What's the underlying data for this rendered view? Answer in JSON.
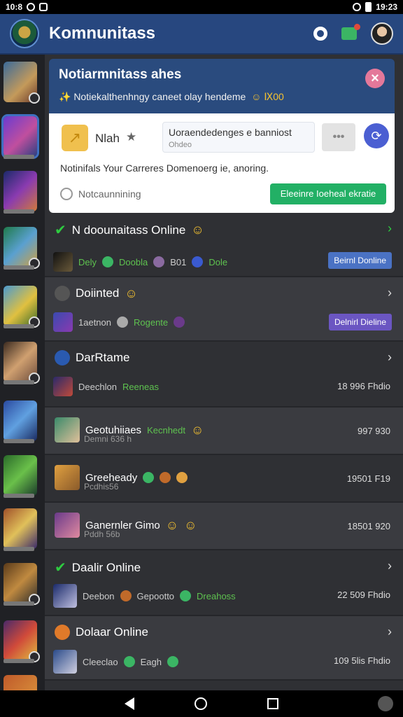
{
  "status_bar": {
    "left": "10:8",
    "time": "19:23"
  },
  "app_bar": {
    "title": "Komnunitass"
  },
  "banner": {
    "title": "Notiarmnitass ahes",
    "subtitle": "✨ Notiekalthenhngy caneet olay hendeme",
    "extra": "☺ Ⅸ00"
  },
  "card": {
    "name": "Nlah",
    "search_value": "Uoraendedenges e banniost",
    "search_placeholder": "Ohdeo",
    "more": "•••",
    "description": "Notinifals Your Carreres  Domenoerg ie, anoring.",
    "status": "Notcaunnining",
    "go_button": "Eleeinre Ioeheal ekratie"
  },
  "rows": [
    {
      "title": "N doounaitass Online",
      "left": "Dely",
      "mid": "Doobla",
      "num": "B01",
      "tail": "Dole",
      "btn": "Beirnl Donline",
      "btn_color": "#4a72c4"
    },
    {
      "title": "Doiinted",
      "left": "1aetnon",
      "mid": "Rogente",
      "btn": "Delnirl Dieline",
      "btn_color": "#6b56c2"
    },
    {
      "title": "DarRtame",
      "left": "Deechlon",
      "mid": "Reeneas",
      "right": "18 996 Fhdio"
    },
    {
      "title": "Geotuhiiaes",
      "mid": "Kecnhedt",
      "sub": "Demni 636 h",
      "right": "997 930"
    },
    {
      "title": "Greeheady",
      "sub": "Pcdhis56",
      "right": "19501 F19"
    },
    {
      "title": "Ganernler Gimo",
      "sub": "Pddh 56b",
      "right": "18501 920"
    },
    {
      "title": "Daalir Online",
      "left": "Deebon",
      "mid": "Gepootto",
      "tail": "Dreahoss",
      "right": "22 509 Fhdio"
    },
    {
      "title": "Dolaar Online",
      "left": "Cleeclao",
      "mid": "Eagh",
      "right": "109 5lis Fhdio"
    }
  ],
  "colors": {
    "app_bar": "#27477f",
    "background": "#2f3034",
    "green": "#22b065",
    "accent_blue": "#4b5fd2"
  }
}
